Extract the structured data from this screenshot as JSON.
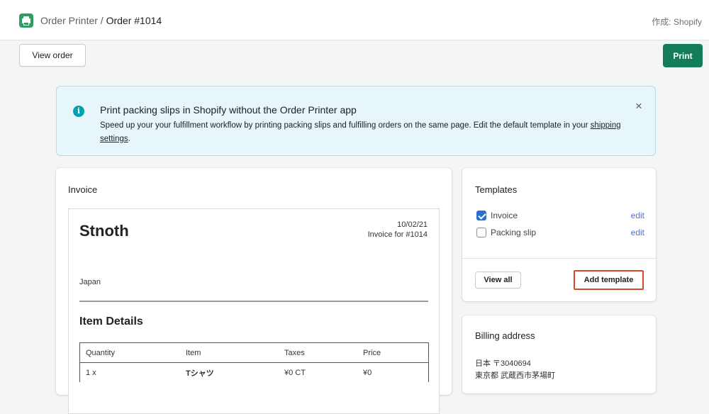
{
  "header": {
    "app_name": "Order Printer",
    "separator": " / ",
    "order_title": "Order #1014",
    "by_line": "作成: Shopify"
  },
  "toolbar": {
    "view_order_label": "View order",
    "print_label": "Print"
  },
  "banner": {
    "title": "Print packing slips in Shopify without the Order Printer app",
    "text_before_link": "Speed up your your fulfillment workflow by printing packing slips and fulfilling orders on the same page. Edit the default template in your ",
    "link_text": "shipping settings",
    "text_after_link": ".",
    "close_symbol": "×"
  },
  "invoice_card": {
    "title": "Invoice",
    "document": {
      "shop_name": "Stnoth",
      "date": "10/02/21",
      "invoice_for": "Invoice for #1014",
      "country": "Japan",
      "section_title": "Item Details",
      "columns": [
        "Quantity",
        "Item",
        "Taxes",
        "Price"
      ],
      "rows": [
        [
          "1 x",
          "Tシャツ",
          "¥0 CT",
          "¥0"
        ]
      ]
    }
  },
  "templates_card": {
    "title": "Templates",
    "items": [
      {
        "label": "Invoice",
        "checked": true,
        "edit_label": "edit"
      },
      {
        "label": "Packing slip",
        "checked": false,
        "edit_label": "edit"
      }
    ],
    "view_all_label": "View all",
    "add_template_label": "Add template"
  },
  "billing_card": {
    "title": "Billing address",
    "lines": [
      "日本 〒3040694",
      "東京都 武蔵西市茅場町"
    ]
  },
  "colors": {
    "print_button": "#137c58",
    "banner_bg": "#e6f6fa",
    "info_icon": "#00a0ac",
    "checkbox_checked": "#2c6ecb",
    "add_template_highlight": "#d8472d"
  },
  "icons": {
    "app": "printer-icon",
    "banner_info": "info-icon",
    "banner_close": "close-icon",
    "checkbox_checked": "checkmark-icon"
  }
}
